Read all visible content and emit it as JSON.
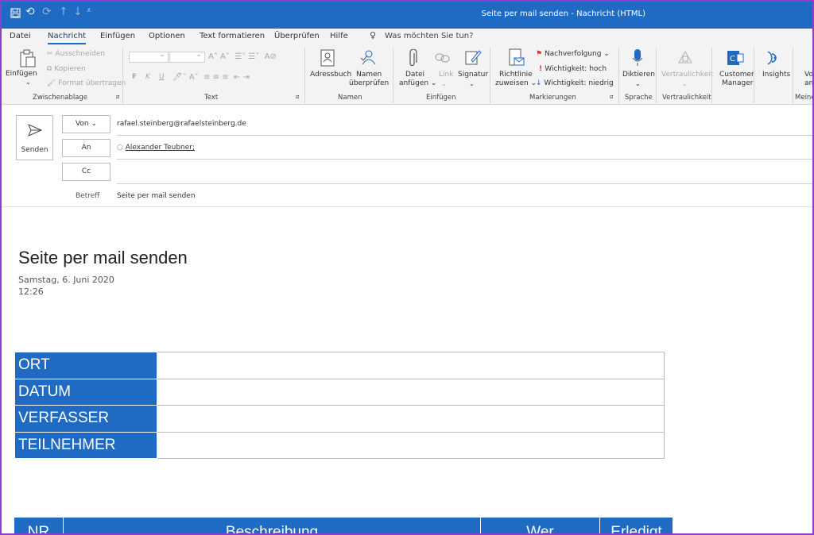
{
  "window": {
    "title": "Seite per mail senden  -  Nachricht (HTML)"
  },
  "quick_access": {
    "save_icon": "save-icon",
    "undo_icon": "undo-icon",
    "redo_icon": "redo-icon",
    "up_icon": "up-arrow-icon",
    "down_icon": "down-arrow-icon",
    "customize_icon": "customize-icon"
  },
  "tabs": [
    "Datei",
    "Nachricht",
    "Einfügen",
    "Optionen",
    "Text formatieren",
    "Überprüfen",
    "Hilfe"
  ],
  "tell_me": "Was möchten Sie tun?",
  "ribbon": {
    "clipboard": {
      "paste": "Einfügen",
      "cut": "Ausschneiden",
      "copy": "Kopieren",
      "format": "Format übertragen",
      "label": "Zwischenablage"
    },
    "text": {
      "label": "Text",
      "bold": "F",
      "italic": "K",
      "underline": "U"
    },
    "names": {
      "address_book": "Adressbuch",
      "check_names_1": "Namen",
      "check_names_2": "überprüfen",
      "label": "Namen"
    },
    "insert": {
      "attach_1": "Datei",
      "attach_2": "anfügen",
      "link": "Link",
      "signature": "Signatur",
      "label": "Einfügen"
    },
    "tags": {
      "policy_1": "Richtlinie",
      "policy_2": "zuweisen",
      "followup": "Nachverfolgung",
      "high": "Wichtigkeit: hoch",
      "low": "Wichtigkeit: niedrig",
      "label": "Markierungen"
    },
    "voice": {
      "dictate": "Diktieren",
      "label": "Sprache"
    },
    "sensitivity": {
      "button": "Vertraulichkeit",
      "label": "Vertraulichkeit"
    },
    "crm": {
      "button_1": "Customer",
      "button_2": "Manager"
    },
    "insights": {
      "button": "Insights"
    },
    "cut_off": {
      "text_1": "Vo",
      "text_2": "an",
      "label": "Meine"
    }
  },
  "compose": {
    "send": "Senden",
    "from_button": "Von",
    "from_value": "rafael.steinberg@rafaelsteinberg.de",
    "to_button": "An",
    "to_value": "Alexander Teubner;",
    "cc_button": "Cc",
    "subject_label": "Betreff",
    "subject_value": "Seite per mail senden"
  },
  "body": {
    "title": "Seite per mail senden",
    "date": "Samstag, 6. Juni 2020",
    "time": "12:26",
    "info_rows": [
      "ORT",
      "DATUM",
      "VERFASSER",
      "TEILNEHMER"
    ],
    "task_headers": [
      "NR",
      "Beschreibung",
      "Wer",
      "Erledigt"
    ]
  },
  "colors": {
    "accent": "#1f6bc4",
    "frame": "#8a3fd1"
  }
}
